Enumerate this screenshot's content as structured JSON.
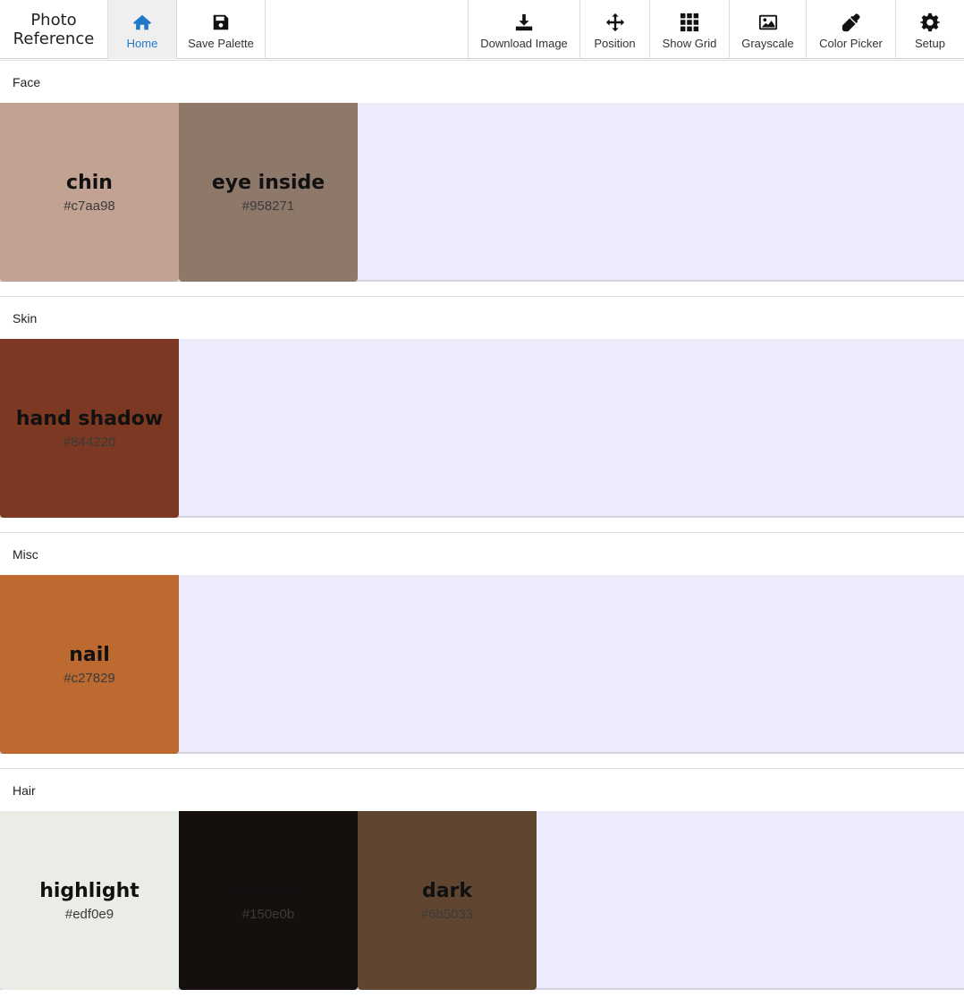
{
  "app": {
    "title_line1": "Photo",
    "title_line2": "Reference"
  },
  "toolbar": {
    "left_buttons": [
      {
        "label": "Home",
        "icon": "home-icon",
        "active": true
      },
      {
        "label": "Save Palette",
        "icon": "save-icon"
      }
    ],
    "right_buttons": [
      {
        "label": "Download Image",
        "icon": "download-icon"
      },
      {
        "label": "Position",
        "icon": "move-icon"
      },
      {
        "label": "Show Grid",
        "icon": "grid-icon"
      },
      {
        "label": "Grayscale",
        "icon": "image-icon"
      },
      {
        "label": "Color Picker",
        "icon": "eyedropper-icon"
      },
      {
        "label": "Setup",
        "icon": "gear-icon"
      }
    ],
    "accent_color": "#1f78c8"
  },
  "sections": [
    {
      "title": "Face",
      "swatches": [
        {
          "name": "chin",
          "hex": "#c7aa98",
          "color": "#c2a292"
        },
        {
          "name": "eye inside",
          "hex": "#958271",
          "color": "#8e786a"
        }
      ]
    },
    {
      "title": "Skin",
      "swatches": [
        {
          "name": "hand shadow",
          "hex": "#844220",
          "color": "#7c3822"
        }
      ]
    },
    {
      "title": "Misc",
      "swatches": [
        {
          "name": "nail",
          "hex": "#c27829",
          "color": "#bd6a30"
        }
      ]
    },
    {
      "title": "Hair",
      "swatches": [
        {
          "name": "highlight",
          "hex": "#edf0e9",
          "color": "#eaece6"
        },
        {
          "name": "shadow",
          "hex": "#150e0b",
          "color": "#15100d"
        },
        {
          "name": "dark",
          "hex": "#6b5033",
          "color": "#604631"
        }
      ]
    }
  ]
}
